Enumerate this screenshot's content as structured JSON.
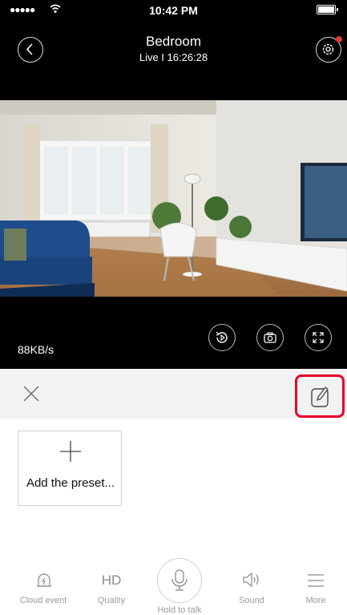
{
  "status_bar": {
    "time": "10:42 PM",
    "signal": "●●●●● ",
    "wifi": "wifi-icon"
  },
  "header": {
    "title": "Bedroom",
    "subtitle": "Live I 16:26:28"
  },
  "video": {
    "bitrate": "88KB/s"
  },
  "controls": {
    "playback_icon": "playback-icon",
    "snapshot_icon": "camera-icon",
    "fullscreen_icon": "fullscreen-icon"
  },
  "preset": {
    "add_label": "Add the preset..."
  },
  "bottom_nav": {
    "items": [
      {
        "label": "Cloud event",
        "icon": "cloud-event-icon"
      },
      {
        "label": "Quality",
        "icon_text": "HD"
      },
      {
        "label": "Hold to talk",
        "icon": "microphone-icon"
      },
      {
        "label": "Sound",
        "icon": "speaker-icon"
      },
      {
        "label": "More",
        "icon": "menu-icon"
      }
    ]
  },
  "colors": {
    "highlight": "#e4002b",
    "settings_badge": "#e53935"
  }
}
